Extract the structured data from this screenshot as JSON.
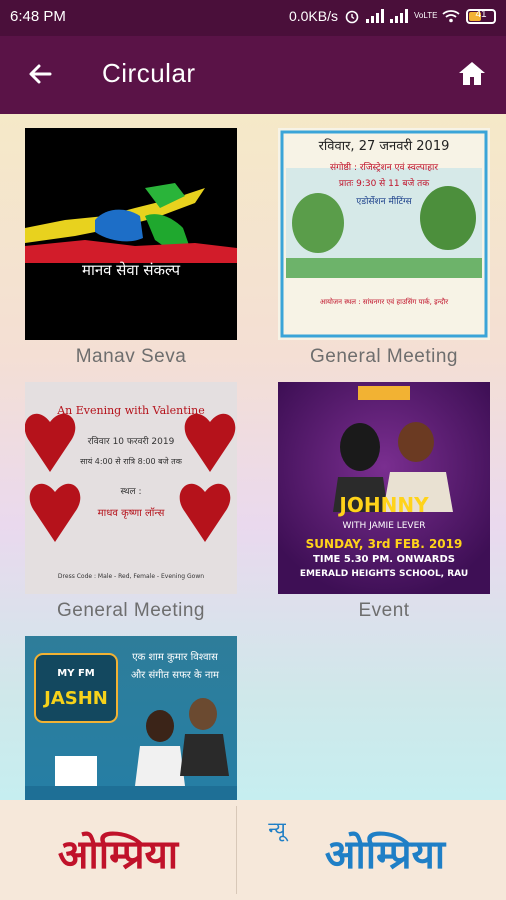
{
  "status": {
    "time": "6:48 PM",
    "net_speed": "0.0KB/s",
    "battery": "41",
    "volte": "VoLTE"
  },
  "appbar": {
    "title": "Circular",
    "back_icon": "arrow-left-icon",
    "home_icon": "home-icon"
  },
  "items": [
    {
      "caption": "Manav Seva",
      "poster_text": "मानव सेवा संकल्प"
    },
    {
      "caption": "General Meeting",
      "poster_lines": [
        "रविवार, 27 जनवरी 2019",
        "संगोष्ठी : रजिस्ट्रेशन एवं स्वल्पाहार",
        "प्रातः 9:30 से 11 बजे तक",
        "एडोर्सेशन मीटिंग्स",
        "आयोजन स्थल : सांघनगर एवं हाउसिंग पार्क, इन्दौर"
      ]
    },
    {
      "caption": "General Meeting",
      "poster_lines": [
        "An Evening with Valentine",
        "रविवार 10 फरवरी 2019",
        "सायं 4:00 से रात्रि 8:00 बजे तक",
        "स्थल :",
        "माधव कृष्णा लॉन्स",
        "Dress Code : Male - Red, Female - Evening Gown"
      ]
    },
    {
      "caption": "Event",
      "poster_lines": [
        "JOHNNY",
        "WITH JAMIE LEVER",
        "SUNDAY, 3rd FEB. 2019",
        "TIME 5.30 PM. ONWARDS",
        "EMERALD HEIGHTS SCHOOL, RAU"
      ]
    },
    {
      "caption": "",
      "poster_lines": [
        "MY FM",
        "JASHN",
        "एक शाम कुमार विश्वास",
        "और संगीत सफर के नाम"
      ]
    }
  ],
  "bottom": {
    "left_logo": "ओम्प्रिया",
    "right_logo_prefix": "न्यू",
    "right_logo": "ओम्प्रिया"
  },
  "colors": {
    "statusbar": "#4a0f3a",
    "appbar": "#5a1347",
    "caption": "#6e6e6e",
    "logo_red": "#c0122a",
    "logo_blue": "#1f7fc6"
  }
}
